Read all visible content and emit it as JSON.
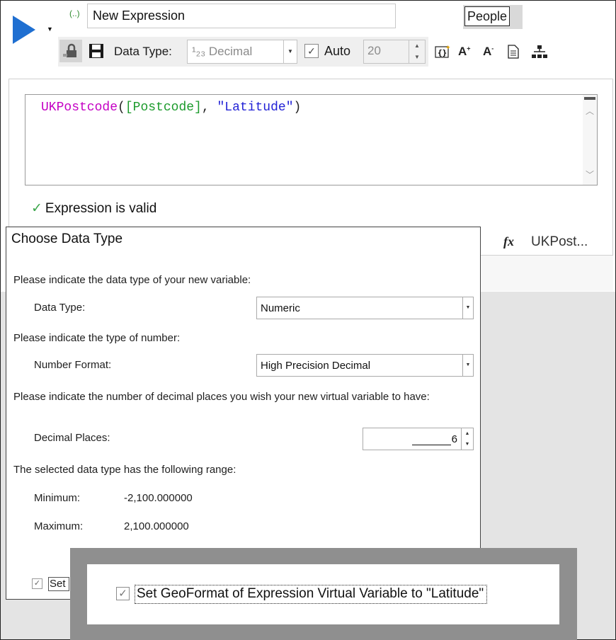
{
  "window": {
    "frame_color": "#222222",
    "background_grey": "#e4e4e4"
  },
  "toolbar": {
    "run_icon": "play-triangle-icon",
    "run_color": "#1f6fd1",
    "paren_icon_text": "(..)",
    "expression_name": "New Expression",
    "category_button": "People",
    "data_type_label": "Data Type:",
    "data_type_value": "¹₂₃ Decimal",
    "auto_checked": true,
    "auto_label": "Auto",
    "width_value": "20",
    "icons": [
      "lock-icon",
      "save-icon",
      "insert-braces-icon",
      "font-increase-icon",
      "font-decrease-icon",
      "document-icon",
      "hierarchy-icon"
    ]
  },
  "editor": {
    "code_fn": "UKPostcode",
    "code_open": "(",
    "code_field": "[Postcode]",
    "code_comma": ", ",
    "code_string": "\"Latitude\"",
    "code_close": ")",
    "validation_text": "Expression is valid",
    "validation_color": "#3aa64a"
  },
  "right_panel": {
    "fx_icon": "fx",
    "function_label": "UKPost..."
  },
  "dialog": {
    "title": "Choose Data Type",
    "prompt_type": "Please indicate the data type of your new variable:",
    "data_type_label": "Data Type:",
    "data_type_value": "Numeric",
    "prompt_number": "Please indicate the type of number:",
    "number_format_label": "Number Format:",
    "number_format_value": "High Precision Decimal",
    "prompt_decimals": "Please indicate the number of decimal places you wish your new virtual variable to have:",
    "decimal_places_label": "Decimal Places:",
    "decimal_places_value": "6",
    "range_text": "The selected data type has the following range:",
    "minimum_label": "Minimum:",
    "minimum_value": "-2,100.000000",
    "maximum_label": "Maximum:",
    "maximum_value": "2,100.000000",
    "set_checkbox_checked": true,
    "set_checkbox_short": "Set"
  },
  "zoom_callout": {
    "checked": true,
    "label": "Set GeoFormat of Expression Virtual Variable to \"Latitude\""
  }
}
